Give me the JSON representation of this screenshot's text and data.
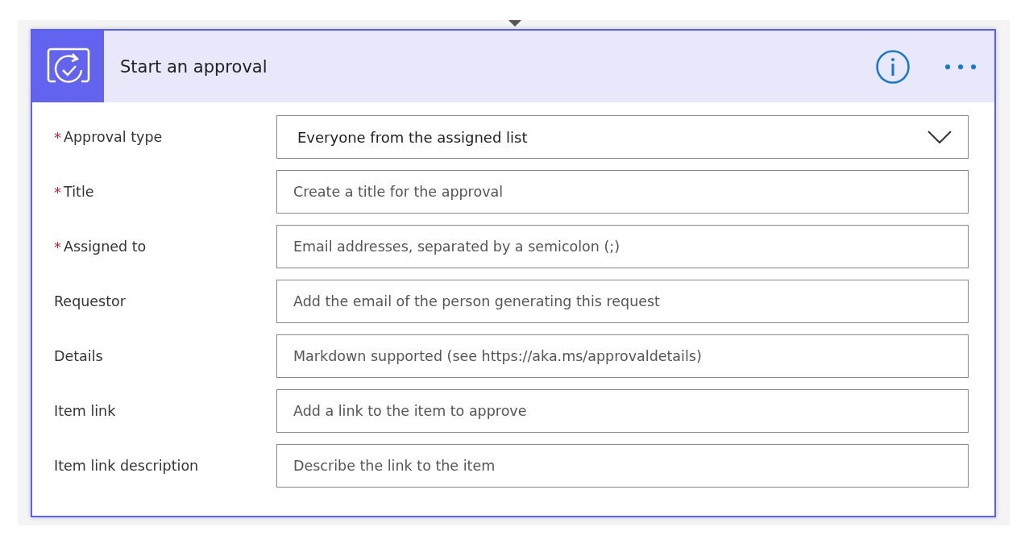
{
  "card": {
    "title": "Start an approval"
  },
  "required_mark": "*",
  "fields": [
    {
      "kind": "dropdown",
      "label": "Approval type",
      "required": true,
      "value": "Everyone from the assigned list"
    },
    {
      "kind": "text",
      "label": "Title",
      "required": true,
      "placeholder": "Create a title for the approval"
    },
    {
      "kind": "text",
      "label": "Assigned to",
      "required": true,
      "placeholder": "Email addresses, separated by a semicolon (;)"
    },
    {
      "kind": "text",
      "label": "Requestor",
      "required": false,
      "placeholder": "Add the email of the person generating this request"
    },
    {
      "kind": "text",
      "label": "Details",
      "required": false,
      "placeholder": "Markdown supported (see https://aka.ms/approvaldetails)"
    },
    {
      "kind": "text",
      "label": "Item link",
      "required": false,
      "placeholder": "Add a link to the item to approve"
    },
    {
      "kind": "text",
      "label": "Item link description",
      "required": false,
      "placeholder": "Describe the link to the item"
    }
  ]
}
